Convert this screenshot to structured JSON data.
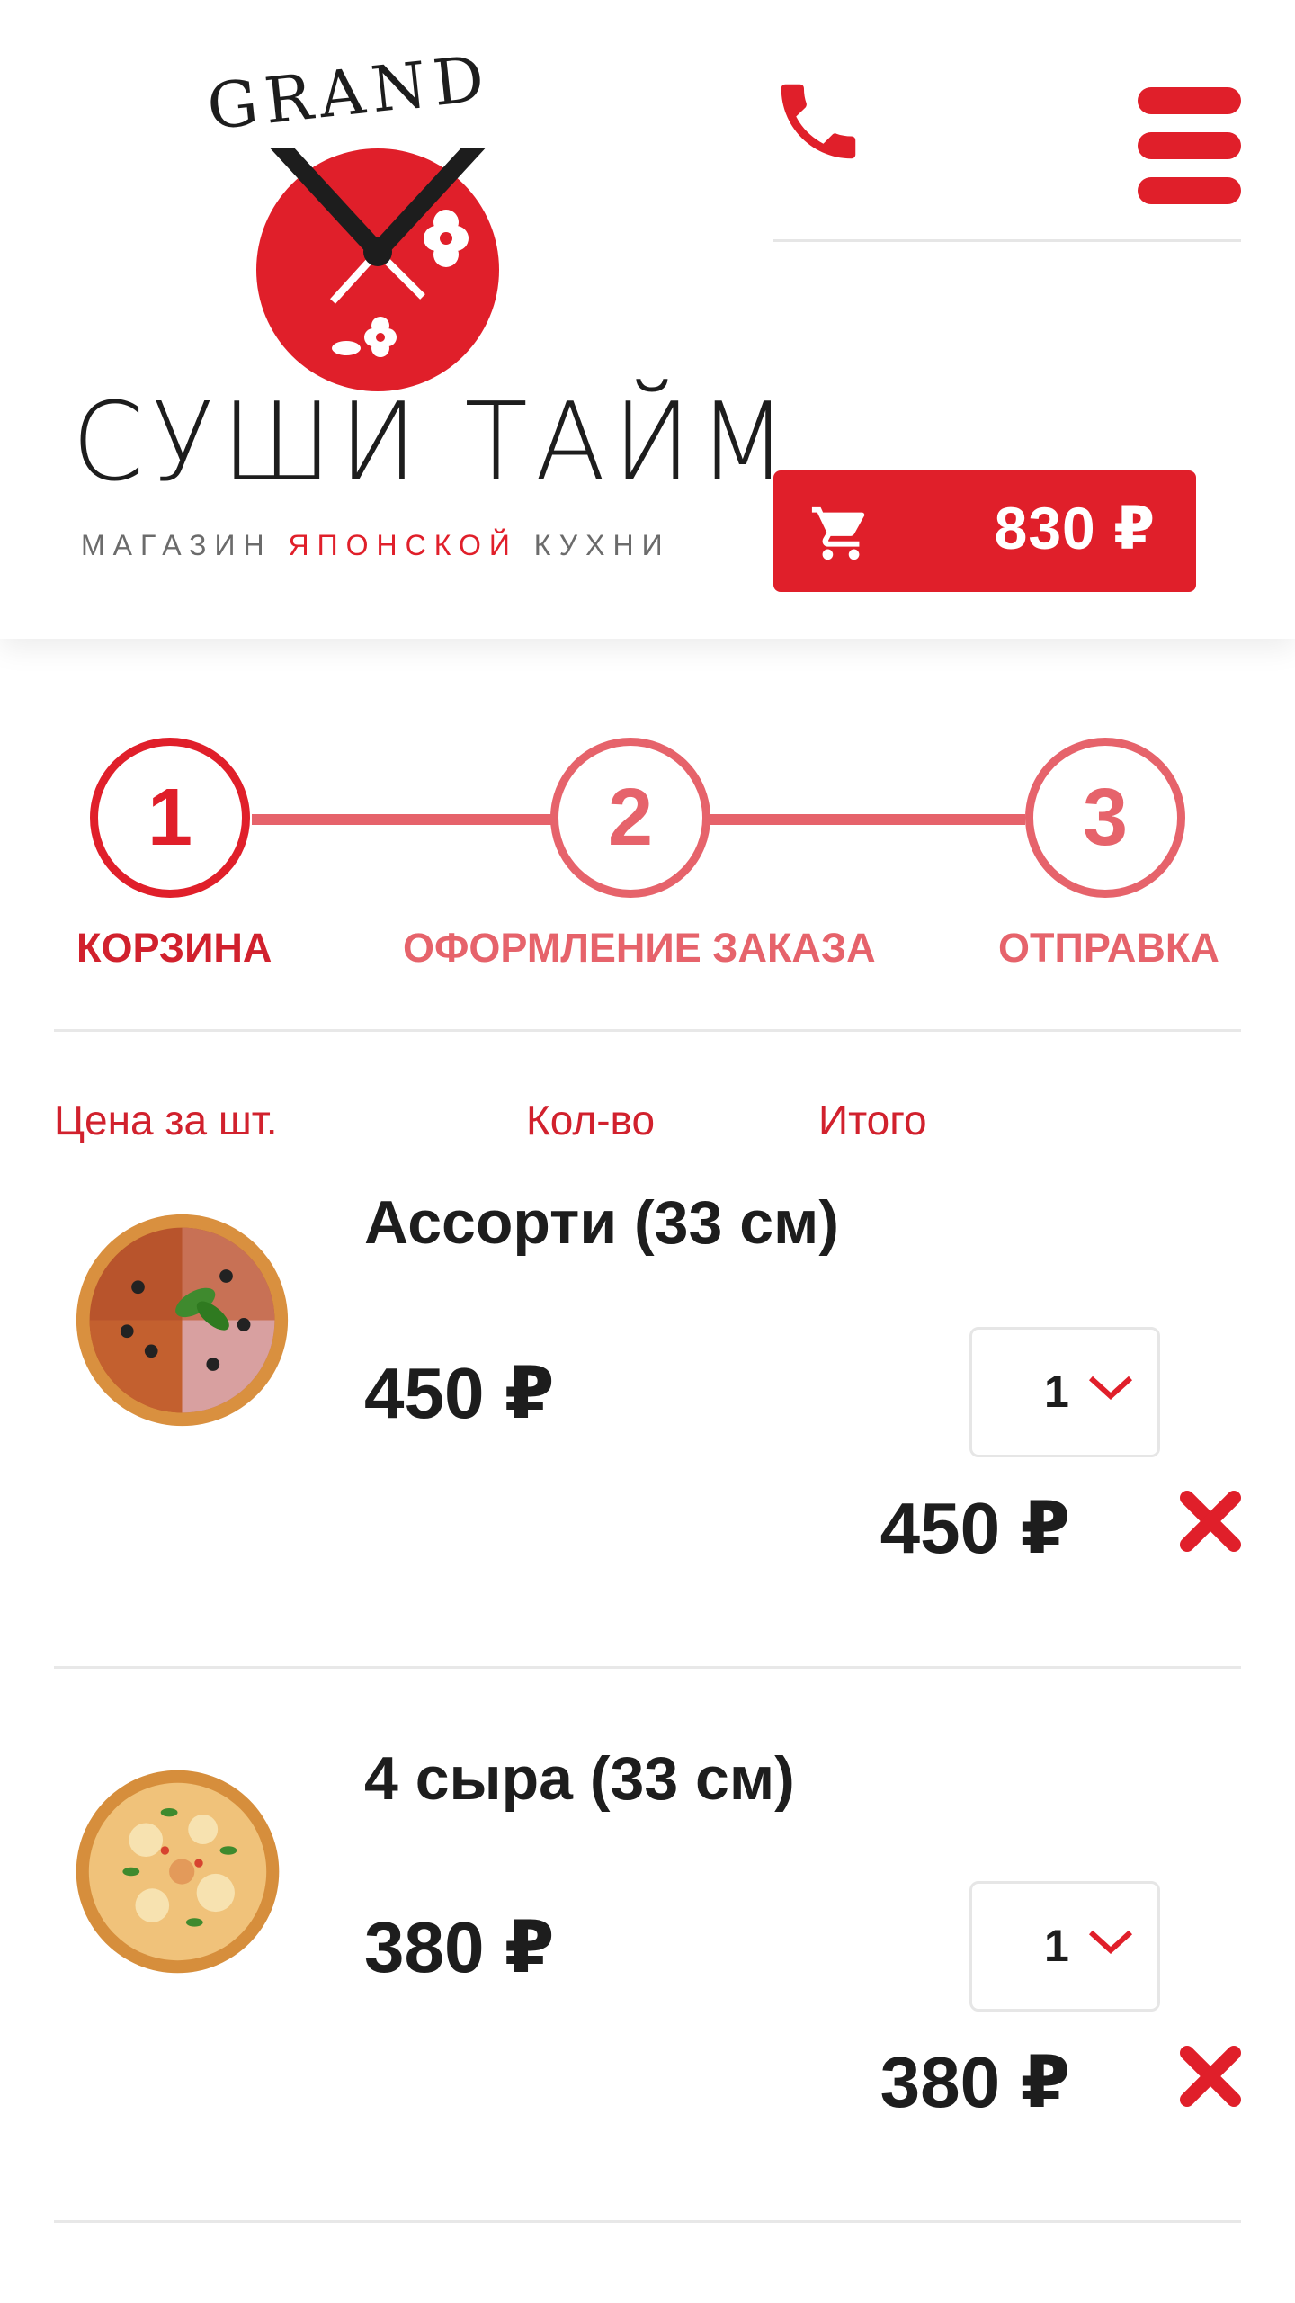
{
  "header": {
    "brand_top": "GRAND",
    "brand_main": "СУШИ ТАЙМ",
    "brand_sub_1": "МАГАЗИН ",
    "brand_sub_2": "ЯПОНСКОЙ",
    "brand_sub_3": " КУХНИ",
    "cart_total": "830 ₽"
  },
  "steps": [
    {
      "number": "1",
      "label": "КОРЗИНА",
      "active": true
    },
    {
      "number": "2",
      "label": "ОФОРМЛЕНИЕ ЗАКАЗА",
      "active": false
    },
    {
      "number": "3",
      "label": "ОТПРАВКА",
      "active": false
    }
  ],
  "columns": {
    "price": "Цена за шт.",
    "qty": "Кол-во",
    "total": "Итого"
  },
  "items": [
    {
      "name": "Ассорти (33 см)",
      "price": "450 ₽",
      "qty": "1",
      "total": "450 ₽"
    },
    {
      "name": "4 сыра (33 см)",
      "price": "380 ₽",
      "qty": "1",
      "total": "380 ₽"
    }
  ],
  "colors": {
    "accent": "#e01f2a",
    "accent_light": "#e6636b",
    "text": "#1d1d1d"
  },
  "icons": {
    "phone": "phone-icon",
    "menu": "hamburger-menu-icon",
    "cart": "cart-icon",
    "chevron": "chevron-down-icon",
    "remove": "close-icon"
  }
}
